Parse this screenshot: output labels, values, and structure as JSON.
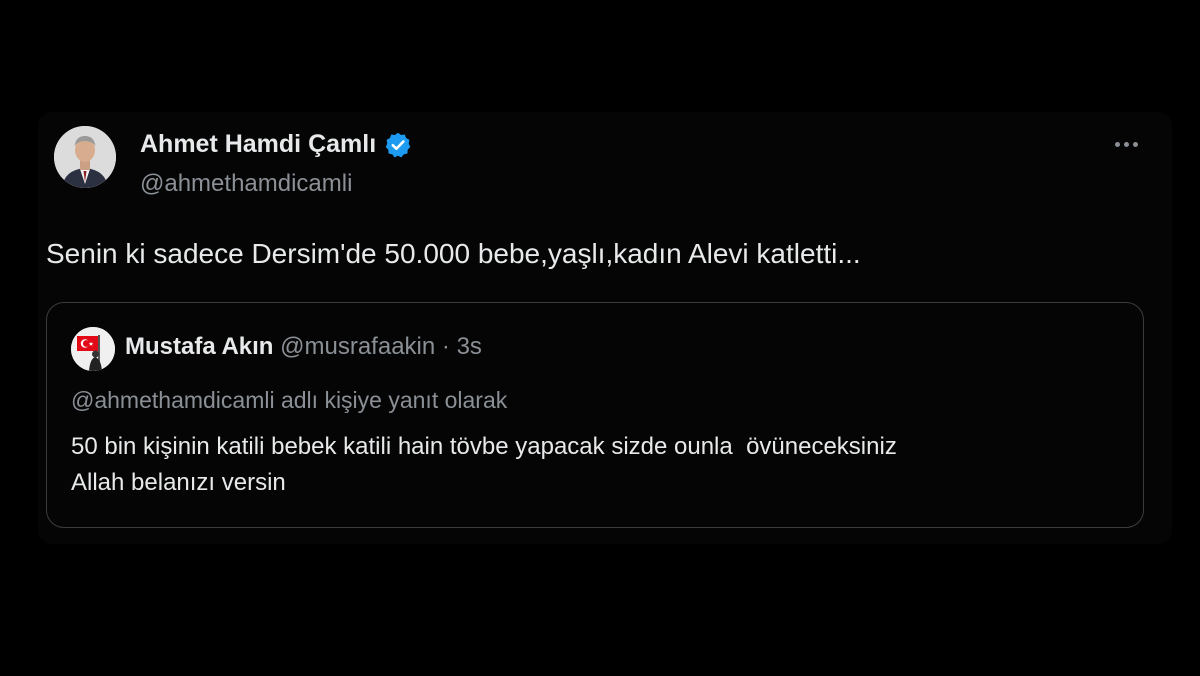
{
  "tweet": {
    "author_name": "Ahmet Hamdi Çamlı",
    "author_handle": "@ahmethamdicamli",
    "text": "Senin ki sadece Dersim'de 50.000 bebe,yaşlı,kadın Alevi katletti...",
    "verified_color": "#1d9bf0"
  },
  "quote": {
    "author_name": "Mustafa Akın",
    "author_handle": "@musrafaakin",
    "separator": "·",
    "time": "3s",
    "replying_to": "@ahmethamdicamli adlı kişiye yanıt olarak",
    "text_lines": [
      "50 bin kişinin katili bebek katili hain tövbe yapacak sizde ounla  övüneceksiniz",
      "Allah belanızı versin"
    ]
  },
  "icons": {
    "verified": "verified-badge-icon",
    "more": "more-options-icon"
  }
}
